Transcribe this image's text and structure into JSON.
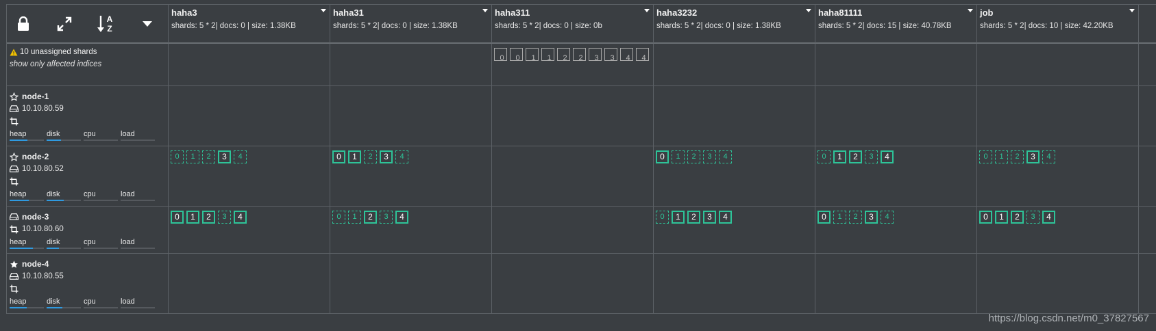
{
  "toolbar": {
    "icons": [
      "lock-icon",
      "expand-icon",
      "sort-az-icon",
      "dropdown-caret-icon"
    ],
    "sort_letters": {
      "top": "A",
      "bottom": "Z"
    }
  },
  "indices": [
    {
      "name": "haha3",
      "stats": "shards: 5 * 2| docs: 0 | size: 1.38KB"
    },
    {
      "name": "haha31",
      "stats": "shards: 5 * 2| docs: 0 | size: 1.38KB"
    },
    {
      "name": "haha311",
      "stats": "shards: 5 * 2| docs: 0 | size: 0b"
    },
    {
      "name": "haha3232",
      "stats": "shards: 5 * 2| docs: 0 | size: 1.38KB"
    },
    {
      "name": "haha81111",
      "stats": "shards: 5 * 2| docs: 15 | size: 40.78KB"
    },
    {
      "name": "job",
      "stats": "shards: 5 * 2| docs: 10 | size: 42.20KB"
    }
  ],
  "unassigned": {
    "label": "10 unassigned shards",
    "filter_link": "show only affected indices",
    "shards_by_index": [
      [],
      [],
      [
        "0",
        "0",
        "1",
        "1",
        "2",
        "2",
        "3",
        "3",
        "4",
        "4"
      ],
      [],
      [],
      []
    ]
  },
  "metric_labels": [
    "heap",
    "disk",
    "cpu",
    "load"
  ],
  "colors": {
    "primary": "#2ec499",
    "metric_bar": "#2f9ae0",
    "warning": "#f2c200"
  },
  "nodes": [
    {
      "name": "node-1",
      "ip": "10.10.80.59",
      "role_icon": "star-outline-icon",
      "metrics": [
        0.52,
        0.42,
        0,
        0
      ],
      "shards": [
        [],
        [],
        [],
        [],
        [],
        []
      ]
    },
    {
      "name": "node-2",
      "ip": "10.10.80.52",
      "role_icon": "star-outline-icon",
      "metrics": [
        0.55,
        0.5,
        0,
        0
      ],
      "shards": [
        [
          {
            "n": "0",
            "p": false
          },
          {
            "n": "1",
            "p": false
          },
          {
            "n": "2",
            "p": false
          },
          {
            "n": "3",
            "p": true
          },
          {
            "n": "4",
            "p": false
          }
        ],
        [
          {
            "n": "0",
            "p": true
          },
          {
            "n": "1",
            "p": true
          },
          {
            "n": "2",
            "p": false
          },
          {
            "n": "3",
            "p": true
          },
          {
            "n": "4",
            "p": false
          }
        ],
        [],
        [
          {
            "n": "0",
            "p": true
          },
          {
            "n": "1",
            "p": false
          },
          {
            "n": "2",
            "p": false
          },
          {
            "n": "3",
            "p": false
          },
          {
            "n": "4",
            "p": false
          }
        ],
        [
          {
            "n": "0",
            "p": false
          },
          {
            "n": "1",
            "p": true
          },
          {
            "n": "2",
            "p": true
          },
          {
            "n": "3",
            "p": false
          },
          {
            "n": "4",
            "p": true
          }
        ],
        [
          {
            "n": "0",
            "p": false
          },
          {
            "n": "1",
            "p": false
          },
          {
            "n": "2",
            "p": false
          },
          {
            "n": "3",
            "p": true
          },
          {
            "n": "4",
            "p": false
          }
        ]
      ]
    },
    {
      "name": "node-3",
      "ip": "10.10.80.60",
      "role_icon": "drive-icon",
      "metrics": [
        0.68,
        0.35,
        0,
        0
      ],
      "shards": [
        [
          {
            "n": "0",
            "p": true
          },
          {
            "n": "1",
            "p": true
          },
          {
            "n": "2",
            "p": true
          },
          {
            "n": "3",
            "p": false
          },
          {
            "n": "4",
            "p": true
          }
        ],
        [
          {
            "n": "0",
            "p": false
          },
          {
            "n": "1",
            "p": false
          },
          {
            "n": "2",
            "p": true
          },
          {
            "n": "3",
            "p": false
          },
          {
            "n": "4",
            "p": true
          }
        ],
        [],
        [
          {
            "n": "0",
            "p": false
          },
          {
            "n": "1",
            "p": true
          },
          {
            "n": "2",
            "p": true
          },
          {
            "n": "3",
            "p": true
          },
          {
            "n": "4",
            "p": true
          }
        ],
        [
          {
            "n": "0",
            "p": true
          },
          {
            "n": "1",
            "p": false
          },
          {
            "n": "2",
            "p": false
          },
          {
            "n": "3",
            "p": true
          },
          {
            "n": "4",
            "p": false
          }
        ],
        [
          {
            "n": "0",
            "p": true
          },
          {
            "n": "1",
            "p": true
          },
          {
            "n": "2",
            "p": true
          },
          {
            "n": "3",
            "p": false
          },
          {
            "n": "4",
            "p": true
          }
        ]
      ]
    },
    {
      "name": "node-4",
      "ip": "10.10.80.55",
      "role_icon": "star-filled-icon",
      "metrics": [
        0.5,
        0.45,
        0,
        0
      ],
      "shards": [
        [],
        [],
        [],
        [],
        [],
        []
      ]
    }
  ],
  "watermark": "https://blog.csdn.net/m0_37827567"
}
